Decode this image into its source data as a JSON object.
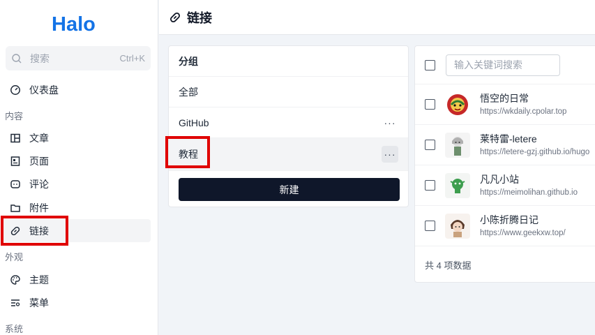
{
  "brand": {
    "logo_text": "Halo",
    "color": "#1473e6"
  },
  "search": {
    "placeholder": "搜索",
    "shortcut": "Ctrl+K"
  },
  "sidebar": {
    "dashboard": "仪表盘",
    "group_content": "内容",
    "posts": "文章",
    "pages": "页面",
    "comments": "评论",
    "attachments": "附件",
    "links": "链接",
    "group_appearance": "外观",
    "themes": "主题",
    "menus": "菜单",
    "group_system": "系统"
  },
  "header": {
    "title": "链接",
    "icon": "link-icon"
  },
  "groups": {
    "title": "分组",
    "items": [
      {
        "label": "全部"
      },
      {
        "label": "GitHub"
      },
      {
        "label": "教程"
      }
    ],
    "more_label": "···",
    "new_button": "新建"
  },
  "links": {
    "search_placeholder": "输入关键词搜索",
    "items": [
      {
        "name": "悟空的日常",
        "url": "https://wkdaily.cpolar.top"
      },
      {
        "name": "莱特雷-letere",
        "url": "https://letere-gzj.github.io/hugo"
      },
      {
        "name": "凡凡小站",
        "url": "https://meimolihan.github.io"
      },
      {
        "name": "小陈折腾日记",
        "url": "https://www.geekxw.top/"
      }
    ],
    "footer": "共 4 项数据"
  },
  "colors": {
    "highlight": "#e00000",
    "primary_button": "#0f172a"
  }
}
